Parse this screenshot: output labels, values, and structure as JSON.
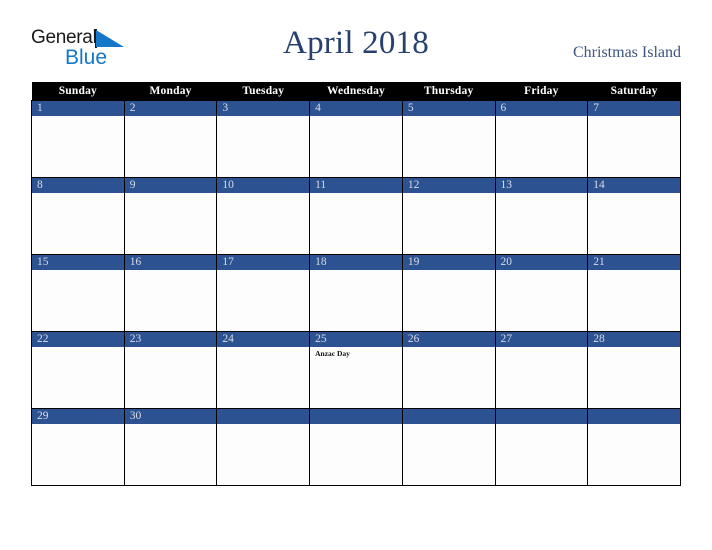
{
  "header": {
    "logo": {
      "word_general": "General",
      "word_blue": "Blue",
      "triangle_icon": "blue-triangle-icon",
      "accent_color": "#1477c8"
    },
    "month_title": "April 2018",
    "location": "Christmas Island"
  },
  "calendar": {
    "weekday_headers": [
      "Sunday",
      "Monday",
      "Tuesday",
      "Wednesday",
      "Thursday",
      "Friday",
      "Saturday"
    ],
    "header_bg": "#000000",
    "daynum_bg": "#2c5291",
    "daynum_color": "#d9dce6",
    "weeks": [
      [
        {
          "day": "1",
          "events": []
        },
        {
          "day": "2",
          "events": []
        },
        {
          "day": "3",
          "events": []
        },
        {
          "day": "4",
          "events": []
        },
        {
          "day": "5",
          "events": []
        },
        {
          "day": "6",
          "events": []
        },
        {
          "day": "7",
          "events": []
        }
      ],
      [
        {
          "day": "8",
          "events": []
        },
        {
          "day": "9",
          "events": []
        },
        {
          "day": "10",
          "events": []
        },
        {
          "day": "11",
          "events": []
        },
        {
          "day": "12",
          "events": []
        },
        {
          "day": "13",
          "events": []
        },
        {
          "day": "14",
          "events": []
        }
      ],
      [
        {
          "day": "15",
          "events": []
        },
        {
          "day": "16",
          "events": []
        },
        {
          "day": "17",
          "events": []
        },
        {
          "day": "18",
          "events": []
        },
        {
          "day": "19",
          "events": []
        },
        {
          "day": "20",
          "events": []
        },
        {
          "day": "21",
          "events": []
        }
      ],
      [
        {
          "day": "22",
          "events": []
        },
        {
          "day": "23",
          "events": []
        },
        {
          "day": "24",
          "events": []
        },
        {
          "day": "25",
          "events": [
            "Anzac Day"
          ]
        },
        {
          "day": "26",
          "events": []
        },
        {
          "day": "27",
          "events": []
        },
        {
          "day": "28",
          "events": []
        }
      ],
      [
        {
          "day": "29",
          "events": []
        },
        {
          "day": "30",
          "events": []
        },
        {
          "day": "",
          "events": []
        },
        {
          "day": "",
          "events": []
        },
        {
          "day": "",
          "events": []
        },
        {
          "day": "",
          "events": []
        },
        {
          "day": "",
          "events": []
        }
      ]
    ]
  }
}
